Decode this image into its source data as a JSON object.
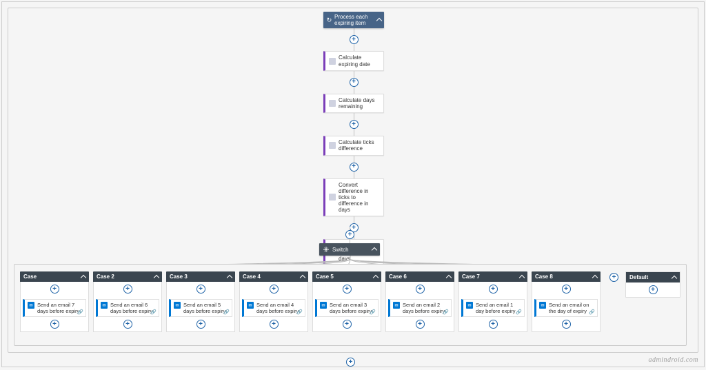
{
  "top": {
    "label": "Process each expiring item"
  },
  "steps": [
    {
      "label": "Calculate expiring date",
      "iconStyle": "lt"
    },
    {
      "label": "Calculate days remaining",
      "iconStyle": "lt"
    },
    {
      "label": "Calculate ticks difference",
      "iconStyle": "lt"
    },
    {
      "label": "Convert difference in ticks to difference in days",
      "iconStyle": "lt"
    },
    {
      "label": "Store calculated difference in days",
      "iconStyle": "dk"
    }
  ],
  "switch": {
    "label": "Switch"
  },
  "cases": [
    {
      "title": "Case",
      "action": "Send an email 7 days before expiry"
    },
    {
      "title": "Case 2",
      "action": "Send an email 6 days before expiry"
    },
    {
      "title": "Case 3",
      "action": "Send an email 5 days before expiry"
    },
    {
      "title": "Case 4",
      "action": "Send an email 4 days before expiry"
    },
    {
      "title": "Case 5",
      "action": "Send an email 3 days before expiry"
    },
    {
      "title": "Case 6",
      "action": "Send an email 2 days before expiry"
    },
    {
      "title": "Case 7",
      "action": "Send an email 1 day before expiry"
    },
    {
      "title": "Case 8",
      "action": "Send an email on the day of expiry"
    }
  ],
  "default": {
    "title": "Default"
  },
  "watermark": "admindroid.com"
}
